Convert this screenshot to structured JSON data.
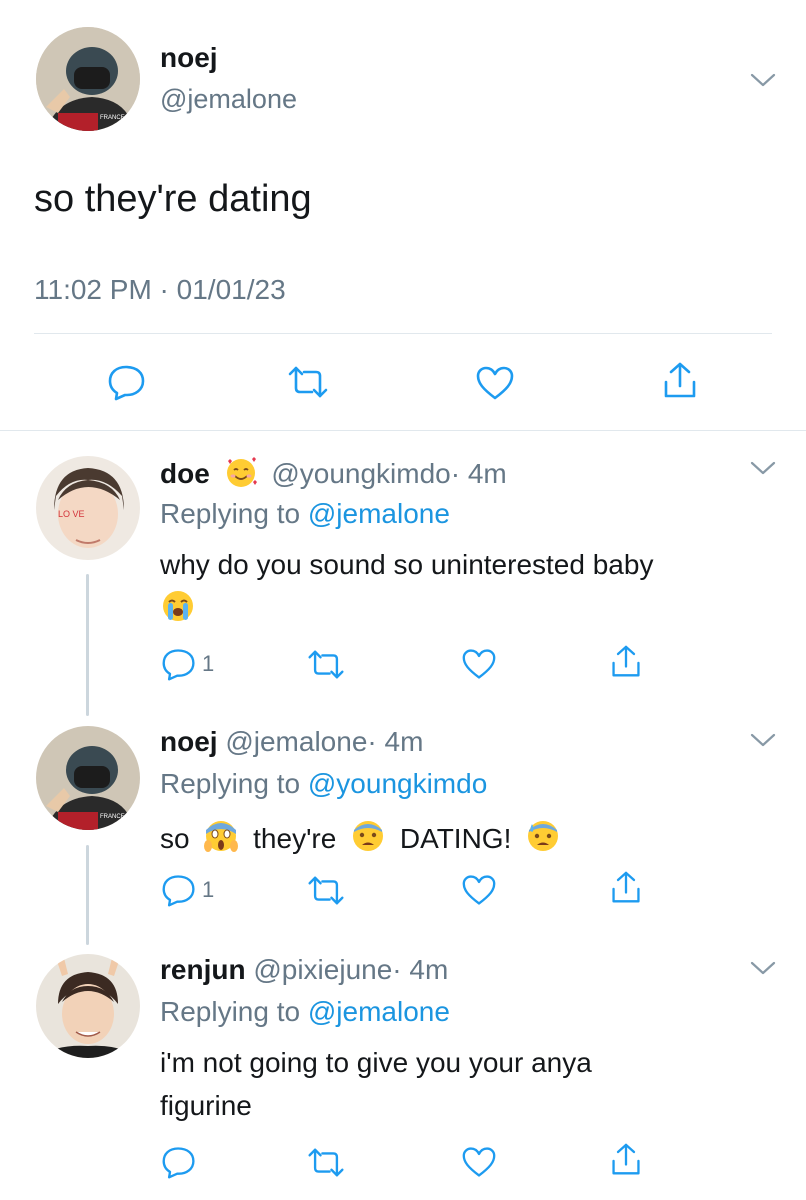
{
  "main_tweet": {
    "display_name": "noej",
    "handle": "@jemalone",
    "text": "so they're dating",
    "timestamp": "11:02 PM · 01/01/23"
  },
  "replies": [
    {
      "display_name": "doe",
      "name_emoji": "smiling-face-with-hearts",
      "handle": "@youngkimdo",
      "time": "· 4m",
      "replying_prefix": "Replying to ",
      "replying_to": "@jemalone",
      "text": "why do you sound so uninterested baby",
      "text_emoji": "loudly-crying-face",
      "reply_count": "1"
    },
    {
      "display_name": "noej",
      "handle": "@jemalone",
      "time": "· 4m",
      "replying_prefix": "Replying to ",
      "replying_to": "@youngkimdo",
      "text_part1": "so",
      "text_part2": "they're",
      "text_part3": "DATING!",
      "emojis": [
        "face-screaming-in-fear",
        "fearful-face",
        "anxious-face-with-sweat"
      ],
      "reply_count": "1"
    },
    {
      "display_name": "renjun",
      "handle": "@pixiejune",
      "time": "· 4m",
      "replying_prefix": "Replying to ",
      "replying_to": "@jemalone",
      "text_line1": "i'm not going to give you your anya",
      "text_line2": "figurine"
    }
  ],
  "avatar_text": {
    "doe": "LO VE",
    "noej": "FRANCE"
  },
  "colors": {
    "link_blue": "#1b95e0",
    "muted_gray": "#657786",
    "divider": "#e1e8ed",
    "thread_line": "#ccd6dd"
  }
}
